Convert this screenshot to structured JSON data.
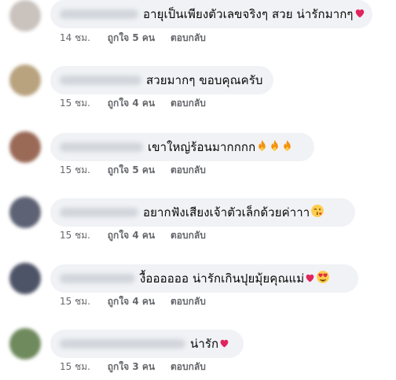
{
  "comments": [
    {
      "text": "อายุเป็นเพียงตัวเลขจริงๆ สวย น่ารักมากๆ",
      "emojis": [
        "heart"
      ],
      "time": "14 ชม.",
      "like": "ถูกใจ 5 คน",
      "reply": "ตอบกลับ",
      "avatar_color": "#c9c2bd"
    },
    {
      "text": "สวยมากๆ ขอบคุณครับ",
      "emojis": [],
      "time": "15 ชม.",
      "like": "ถูกใจ 4 คน",
      "reply": "ตอบกลับ",
      "avatar_color": "#b9a27e"
    },
    {
      "text": "เขาใหญ่ร้อนมากกกก",
      "emojis": [
        "fire",
        "fire",
        "fire"
      ],
      "time": "15 ชม.",
      "like": "ถูกใจ 5 คน",
      "reply": "ตอบกลับ",
      "avatar_color": "#9a6a57"
    },
    {
      "text": "อยากฟังเสียงเจ้าตัวเล็กด้วยค่าาา",
      "emojis": [
        "kiss-face"
      ],
      "time": "15 ชม.",
      "like": "ถูกใจ 4 คน",
      "reply": "ตอบกลับ",
      "avatar_color": "#5d6274"
    },
    {
      "text": "งื้ออออออ น่ารักเกินปุยมุ้ยคุณแม่",
      "emojis": [
        "heart",
        "heart-eyes-face"
      ],
      "time": "15 ชม.",
      "like": "ถูกใจ 4 คน",
      "reply": "ตอบกลับ",
      "avatar_color": "#4e5467"
    },
    {
      "text": "น่ารัก",
      "emojis": [
        "heart"
      ],
      "time": "15 ชม.",
      "like": "ถูกใจ 3 คน",
      "reply": "ตอบกลับ",
      "avatar_color": "#6f8a5d"
    }
  ],
  "colors": {
    "bubble_bg": "#f0f2f5",
    "meta_text": "#65676b",
    "body_text": "#050505",
    "heart": "#e0245e",
    "fire": "#f4900c"
  }
}
